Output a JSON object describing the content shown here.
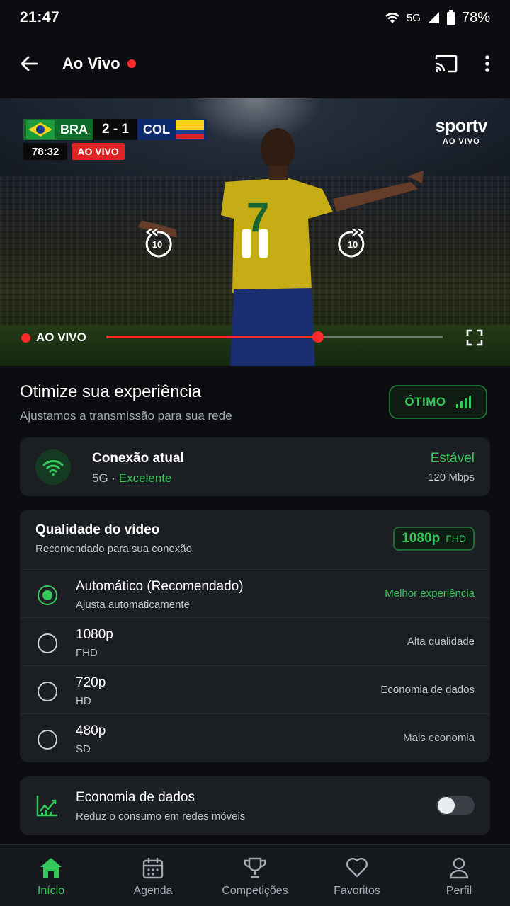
{
  "status_bar": {
    "time": "21:47",
    "network": "5G",
    "battery": "78%"
  },
  "app_bar": {
    "title": "Ao Vivo"
  },
  "player": {
    "home_team": "BRA",
    "score": "2 - 1",
    "away_team": "COL",
    "match_clock": "78:32",
    "live_badge": "AO VIVO",
    "brand_name": "sportv",
    "brand_sub": "AO VIVO",
    "rewind_seconds": "10",
    "forward_seconds": "10",
    "live_label": "AO VIVO",
    "progress_fraction": 0.63
  },
  "optimize": {
    "title": "Otimize sua experiência",
    "subtitle": "Ajustamos a transmissão para sua rede",
    "badge": "ÓTIMO"
  },
  "connection": {
    "title": "Conexão atual",
    "network": "5G",
    "separator": " · ",
    "quality": "Excelente",
    "status": "Estável",
    "speed": "120 Mbps"
  },
  "video_quality": {
    "title": "Qualidade do vídeo",
    "subtitle": "Recomendado para sua conexão",
    "current": "1080p",
    "current_tag": "FHD",
    "options": [
      {
        "label": "Automático (Recomendado)",
        "sub": "Ajusta automaticamente",
        "note": "Melhor experiência",
        "selected": true
      },
      {
        "label": "1080p",
        "sub": "FHD",
        "note": "Alta qualidade",
        "selected": false
      },
      {
        "label": "720p",
        "sub": "HD",
        "note": "Economia de dados",
        "selected": false
      },
      {
        "label": "480p",
        "sub": "SD",
        "note": "Mais economia",
        "selected": false
      }
    ]
  },
  "data_saver": {
    "title": "Economia de dados",
    "subtitle": "Reduz o consumo em redes móveis",
    "enabled": false
  },
  "bottom_nav": [
    {
      "label": "Início",
      "icon": "home-icon",
      "active": true
    },
    {
      "label": "Agenda",
      "icon": "calendar-icon",
      "active": false
    },
    {
      "label": "Competições",
      "icon": "trophy-icon",
      "active": false
    },
    {
      "label": "Favoritos",
      "icon": "heart-icon",
      "active": false
    },
    {
      "label": "Perfil",
      "icon": "profile-icon",
      "active": false
    }
  ],
  "colors": {
    "accent": "#34c759",
    "live": "#ff2a2a",
    "background": "#0b0d10",
    "card": "#1b1e23"
  }
}
